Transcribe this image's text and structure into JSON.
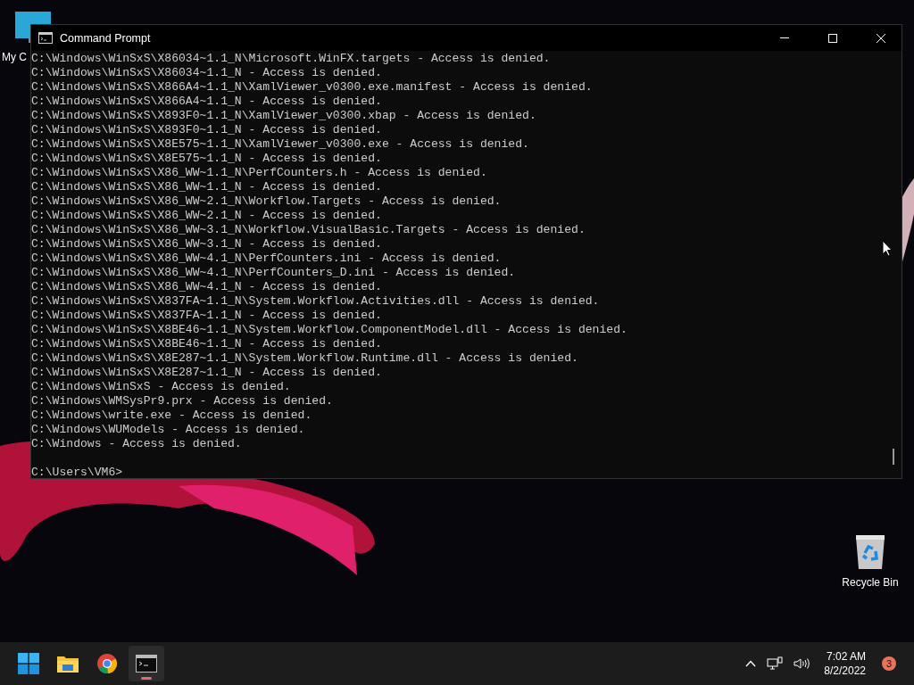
{
  "desktop_icons": [
    {
      "kind": "computer",
      "label": "My C"
    },
    {
      "kind": "recycle",
      "label": "Recycle Bin"
    }
  ],
  "window": {
    "title": "Command Prompt",
    "lines": [
      "C:\\Windows\\WinSxS\\X86034~1.1_N\\Microsoft.WinFX.targets - Access is denied.",
      "C:\\Windows\\WinSxS\\X86034~1.1_N - Access is denied.",
      "C:\\Windows\\WinSxS\\X866A4~1.1_N\\XamlViewer_v0300.exe.manifest - Access is denied.",
      "C:\\Windows\\WinSxS\\X866A4~1.1_N - Access is denied.",
      "C:\\Windows\\WinSxS\\X893F0~1.1_N\\XamlViewer_v0300.xbap - Access is denied.",
      "C:\\Windows\\WinSxS\\X893F0~1.1_N - Access is denied.",
      "C:\\Windows\\WinSxS\\X8E575~1.1_N\\XamlViewer_v0300.exe - Access is denied.",
      "C:\\Windows\\WinSxS\\X8E575~1.1_N - Access is denied.",
      "C:\\Windows\\WinSxS\\X86_WW~1.1_N\\PerfCounters.h - Access is denied.",
      "C:\\Windows\\WinSxS\\X86_WW~1.1_N - Access is denied.",
      "C:\\Windows\\WinSxS\\X86_WW~2.1_N\\Workflow.Targets - Access is denied.",
      "C:\\Windows\\WinSxS\\X86_WW~2.1_N - Access is denied.",
      "C:\\Windows\\WinSxS\\X86_WW~3.1_N\\Workflow.VisualBasic.Targets - Access is denied.",
      "C:\\Windows\\WinSxS\\X86_WW~3.1_N - Access is denied.",
      "C:\\Windows\\WinSxS\\X86_WW~4.1_N\\PerfCounters.ini - Access is denied.",
      "C:\\Windows\\WinSxS\\X86_WW~4.1_N\\PerfCounters_D.ini - Access is denied.",
      "C:\\Windows\\WinSxS\\X86_WW~4.1_N - Access is denied.",
      "C:\\Windows\\WinSxS\\X837FA~1.1_N\\System.Workflow.Activities.dll - Access is denied.",
      "C:\\Windows\\WinSxS\\X837FA~1.1_N - Access is denied.",
      "C:\\Windows\\WinSxS\\X8BE46~1.1_N\\System.Workflow.ComponentModel.dll - Access is denied.",
      "C:\\Windows\\WinSxS\\X8BE46~1.1_N - Access is denied.",
      "C:\\Windows\\WinSxS\\X8E287~1.1_N\\System.Workflow.Runtime.dll - Access is denied.",
      "C:\\Windows\\WinSxS\\X8E287~1.1_N - Access is denied.",
      "C:\\Windows\\WinSxS - Access is denied.",
      "C:\\Windows\\WMSysPr9.prx - Access is denied.",
      "C:\\Windows\\write.exe - Access is denied.",
      "C:\\Windows\\WUModels - Access is denied.",
      "C:\\Windows - Access is denied."
    ],
    "prompt": "C:\\Users\\VM6>"
  },
  "taskbar": {
    "apps": [
      {
        "kind": "start",
        "active": false
      },
      {
        "kind": "folder",
        "active": false
      },
      {
        "kind": "chrome",
        "active": false
      },
      {
        "kind": "terminal",
        "active": true
      }
    ],
    "time": "7:02 AM",
    "date": "8/2/2022",
    "badge": "3"
  }
}
